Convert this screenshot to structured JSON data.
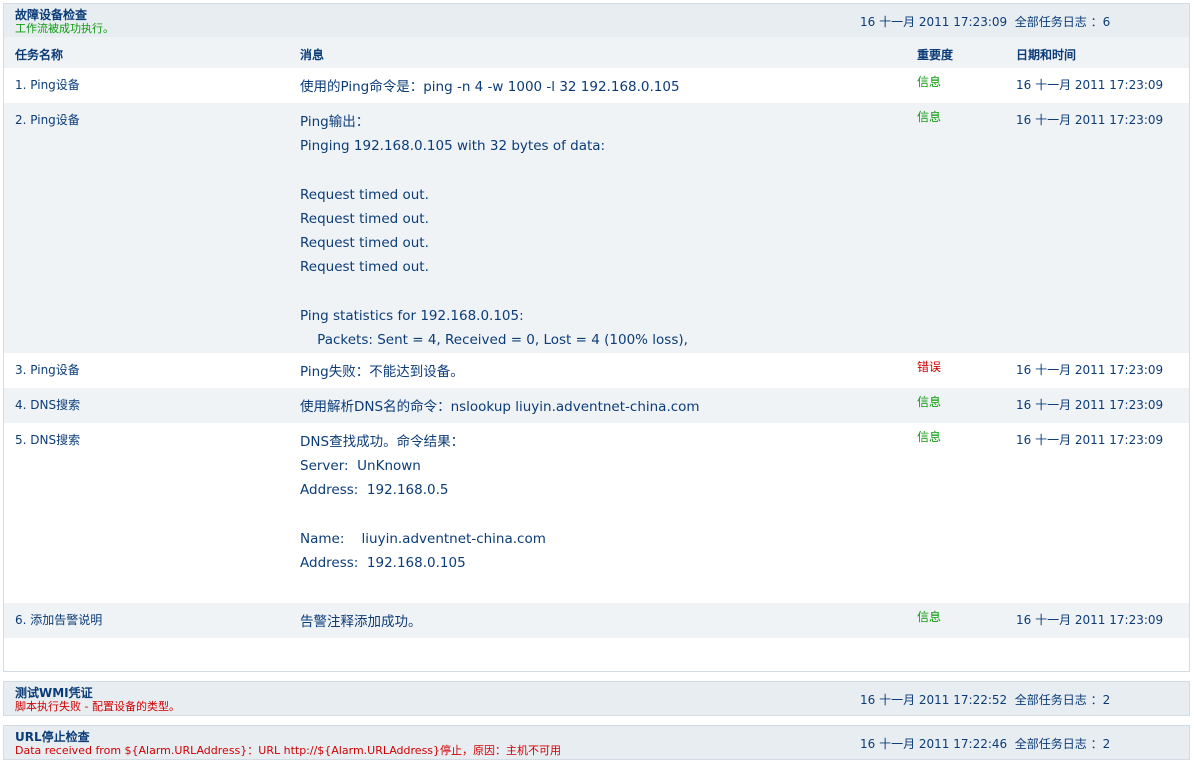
{
  "workflows": [
    {
      "title": "故障设备检查",
      "status": "工作流被成功执行。",
      "timestamp": "16 十一月 2011 17:23:09",
      "log_label": "全部任务日志 ：6",
      "columns": {
        "task": "任务名称",
        "message": "消息",
        "severity": "重要度",
        "datetime": "日期和时间"
      },
      "rows": [
        {
          "task": "1. Ping设备",
          "message": "使用的Ping命令是：ping -n 4 -w 1000 -l 32 192.168.0.105",
          "severity": "信息",
          "datetime": "16 十一月 2011 17:23:09"
        },
        {
          "task": "2. Ping设备",
          "message": "Ping输出：\nPinging 192.168.0.105 with 32 bytes of data:\n\nRequest timed out.\nRequest timed out.\nRequest timed out.\nRequest timed out.\n\nPing statistics for 192.168.0.105:\n    Packets: Sent = 4, Received = 0, Lost = 4 (100% loss),",
          "severity": "信息",
          "datetime": "16 十一月 2011 17:23:09"
        },
        {
          "task": "3. Ping设备",
          "message": "Ping失败：不能达到设备。",
          "severity": "错误",
          "datetime": "16 十一月 2011 17:23:09"
        },
        {
          "task": "4. DNS搜索",
          "message": "使用解析DNS名的命令：nslookup liuyin.adventnet-china.com",
          "severity": "信息",
          "datetime": "16 十一月 2011 17:23:09"
        },
        {
          "task": "5. DNS搜索",
          "message": "DNS查找成功。命令结果：\nServer:  UnKnown\nAddress:  192.168.0.5\n\nName:    liuyin.adventnet-china.com\nAddress:  192.168.0.105",
          "severity": "信息",
          "datetime": "16 十一月 2011 17:23:09"
        },
        {
          "task": "6. 添加告警说明",
          "message": "告警注释添加成功。",
          "severity": "信息",
          "datetime": "16 十一月 2011 17:23:09"
        }
      ]
    },
    {
      "title": "测试WMI凭证",
      "status": "脚本执行失败 - 配置设备的类型。",
      "timestamp": "16 十一月 2011 17:22:52",
      "log_label": "全部任务日志 ：2"
    },
    {
      "title": "URL停止检查",
      "status": "Data received from ${Alarm.URLAddress}：URL http://${Alarm.URLAddress}停止，原因：主机不可用",
      "timestamp": "16 十一月 2011 17:22:46",
      "log_label": "全部任务日志 ：2"
    }
  ],
  "colors": {
    "link": "#0b3c78",
    "success": "#0c9a0c",
    "error": "#d10000",
    "header_bg": "#e8edf2",
    "alt_row_bg": "#f0f3f6"
  }
}
